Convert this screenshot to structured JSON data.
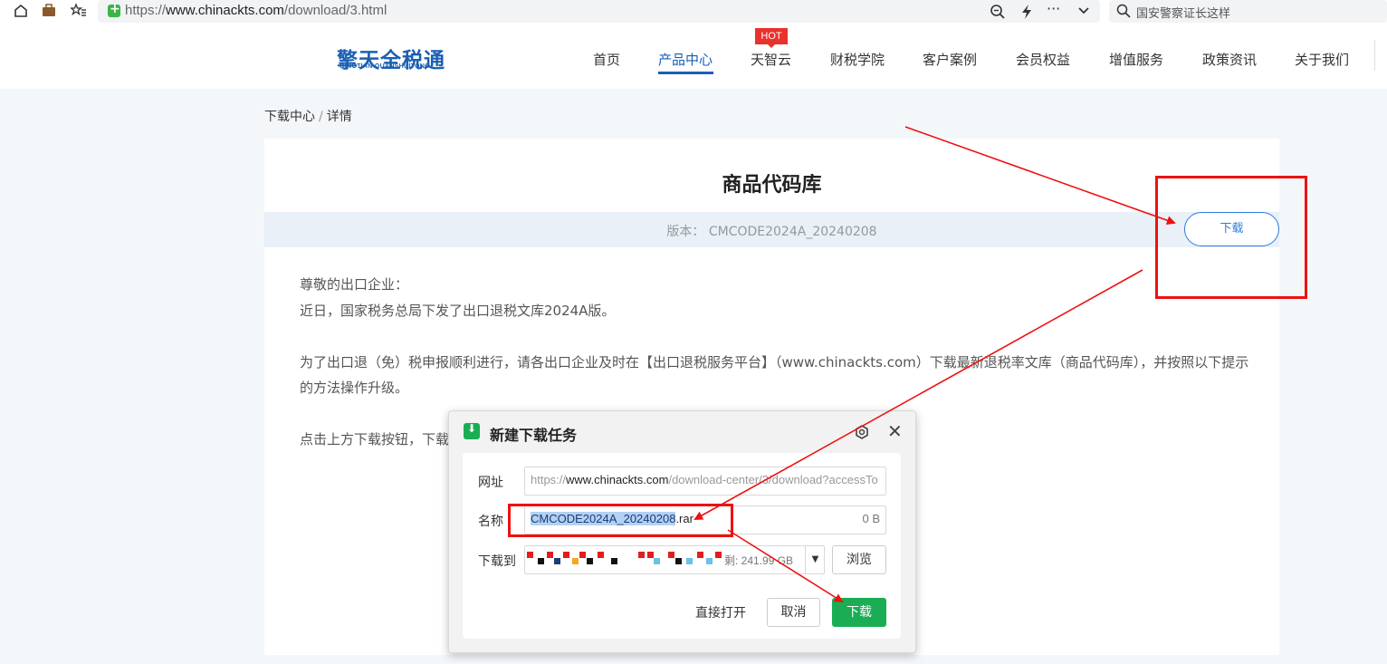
{
  "browser": {
    "url_scheme": "https://",
    "url_host": "www.chinackts.com",
    "url_path": "/download/3.html",
    "search_text": "国安警察证长这样"
  },
  "site": {
    "logo_cn": "擎天全税通",
    "logo_en": "QINGTIAN QUANSHUITONG",
    "hot_badge": "HOT",
    "nav": [
      {
        "label": "首页"
      },
      {
        "label": "产品中心"
      },
      {
        "label": "天智云"
      },
      {
        "label": "财税学院"
      },
      {
        "label": "客户案例"
      },
      {
        "label": "会员权益"
      },
      {
        "label": "增值服务"
      },
      {
        "label": "政策资讯"
      },
      {
        "label": "关于我们"
      }
    ]
  },
  "breadcrumb": {
    "root": "下载中心",
    "sep": "/",
    "current": "详情"
  },
  "article": {
    "title": "商品代码库",
    "version_label": "版本：",
    "version_value": "CMCODE2024A_20240208",
    "download_button": "下载",
    "greeting": "尊敬的出口企业：",
    "line1": "近日，国家税务总局下发了出口退税文库2024A版。",
    "para2": "为了出口退（免）税申报顺利进行，请各出口企业及时在【出口退税服务平台】（www.chinackts.com）下载最新退税率文库（商品代码库），并按照以下提示的方法操作升级。",
    "para3_prefix": "点击上方下载按钮，下载"
  },
  "dialog": {
    "title": "新建下载任务",
    "url_label": "网址",
    "url_scheme": "https://",
    "url_host": "www.chinackts.com",
    "url_rest": "/download-center/3/download?accessTo",
    "name_label": "名称",
    "name_selected": "CMCODE2024A_20240208",
    "name_ext": ".rar",
    "name_size": "0 B",
    "dest_label": "下载到",
    "dest_free": "剩: 241.99 GB",
    "browse_button": "浏览",
    "open_directly": "直接打开",
    "cancel_button": "取消",
    "download_button": "下载"
  },
  "colors": {
    "brand_blue": "#1a5fb4",
    "hot_red": "#e8322b",
    "annotation_red": "#ee1111",
    "download_green": "#1aad54"
  }
}
